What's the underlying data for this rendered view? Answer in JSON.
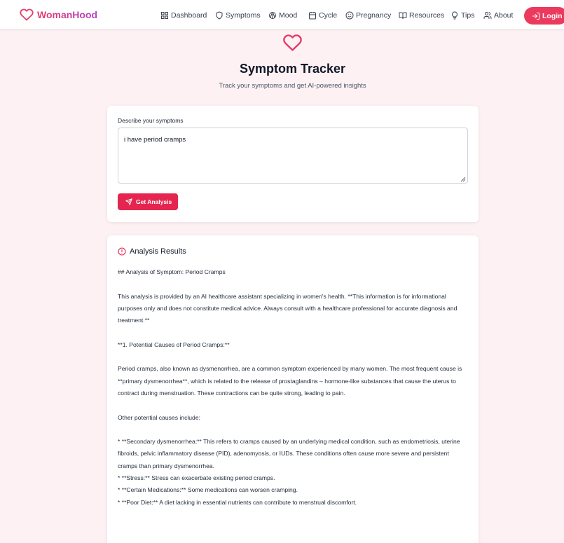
{
  "app": {
    "brand": "WomanHood",
    "colors": {
      "accent": "#e5254f",
      "brand_start": "#e63b6a",
      "brand_end": "#b43fc4",
      "background": "#fdf1f3"
    }
  },
  "nav": {
    "items": [
      {
        "label": "Dashboard",
        "icon": "dashboard-icon"
      },
      {
        "label": "Symptoms",
        "icon": "shield-icon"
      },
      {
        "label": "Mood",
        "icon": "brain-icon"
      },
      {
        "label": "Cycle",
        "icon": "calendar-icon"
      },
      {
        "label": "Pregnancy",
        "icon": "smile-icon"
      },
      {
        "label": "Resources",
        "icon": "book-icon"
      },
      {
        "label": "Tips",
        "icon": "lightbulb-icon"
      },
      {
        "label": "About",
        "icon": "users-icon"
      }
    ],
    "login_label": "Login"
  },
  "page": {
    "title": "Symptom Tracker",
    "subtitle": "Track your symptoms and get AI-powered insights"
  },
  "input_card": {
    "label": "Describe your symptoms",
    "value": "i have period cramps",
    "button_label": "Get Analysis"
  },
  "results": {
    "title": "Analysis Results",
    "heading": "## Analysis of Symptom: Period Cramps",
    "para1": "This analysis is provided by an AI healthcare assistant specializing in women's health. **This information is for informational purposes only and does not constitute medical advice. Always consult with a healthcare professional for accurate diagnosis and treatment.**",
    "section1": "**1. Potential Causes of Period Cramps:**",
    "para2": "Period cramps, also known as dysmenorrhea, are a common symptom experienced by many women. The most frequent cause is **primary dysmenorrhea**, which is related to the release of prostaglandins – hormone-like substances that cause the uterus to contract during menstruation. These contractions can be quite strong, leading to pain.",
    "other_intro": "Other potential causes include:",
    "bullets": [
      "* **Secondary dysmenorrhea:** This refers to cramps caused by an underlying medical condition, such as endometriosis, uterine fibroids, pelvic inflammatory disease (PID), adenomyosis, or IUDs. These conditions often cause more severe and persistent cramps than primary dysmenorrhea.",
      "* **Stress:** Stress can exacerbate existing period cramps.",
      "* **Certain Medications:** Some medications can worsen cramping.",
      "* **Poor Diet:** A diet lacking in essential nutrients can contribute to menstrual discomfort."
    ]
  }
}
